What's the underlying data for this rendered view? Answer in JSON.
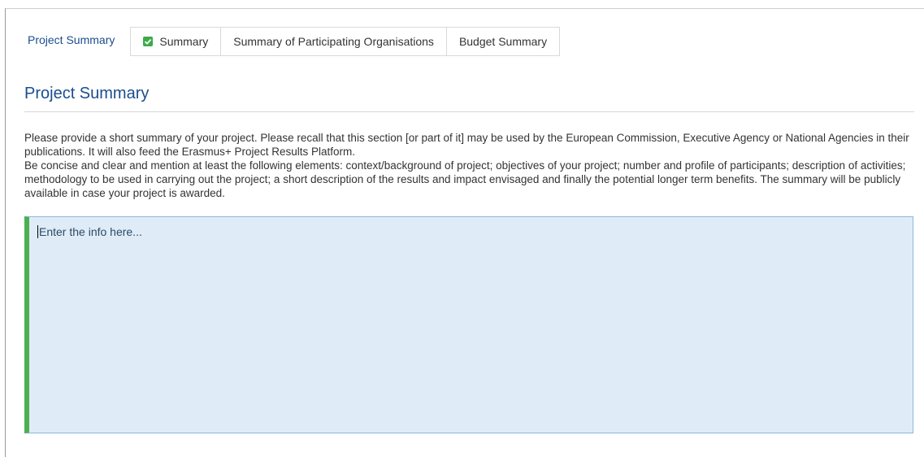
{
  "tabs": [
    {
      "label": "Project Summary",
      "active": true
    },
    {
      "label": "Summary",
      "icon": "check-icon",
      "status_color": "#3cab48"
    },
    {
      "label": "Summary of Participating Organisations"
    },
    {
      "label": "Budget Summary"
    }
  ],
  "section": {
    "title": "Project Summary"
  },
  "instructions": {
    "paragraph1": "Please provide a short summary of your project. Please recall that this section [or part of it] may be used by the European Commission, Executive Agency or National Agencies in their publications. It will also feed the Erasmus+ Project Results Platform.",
    "paragraph2": "Be concise and clear and mention at least the following elements: context/background of project; objectives of your project; number and profile of participants; description of activities; methodology to be used in carrying out the project; a short description of the results and impact envisaged and finally the potential longer term benefits. The summary will be publicly available in case your project is awarded."
  },
  "editor": {
    "placeholder": "Enter the info here...",
    "value": ""
  },
  "colors": {
    "accent": "#1a4d8f",
    "editor_bg": "#dfecf7",
    "editor_bar": "#4caf50",
    "check": "#3cab48"
  }
}
